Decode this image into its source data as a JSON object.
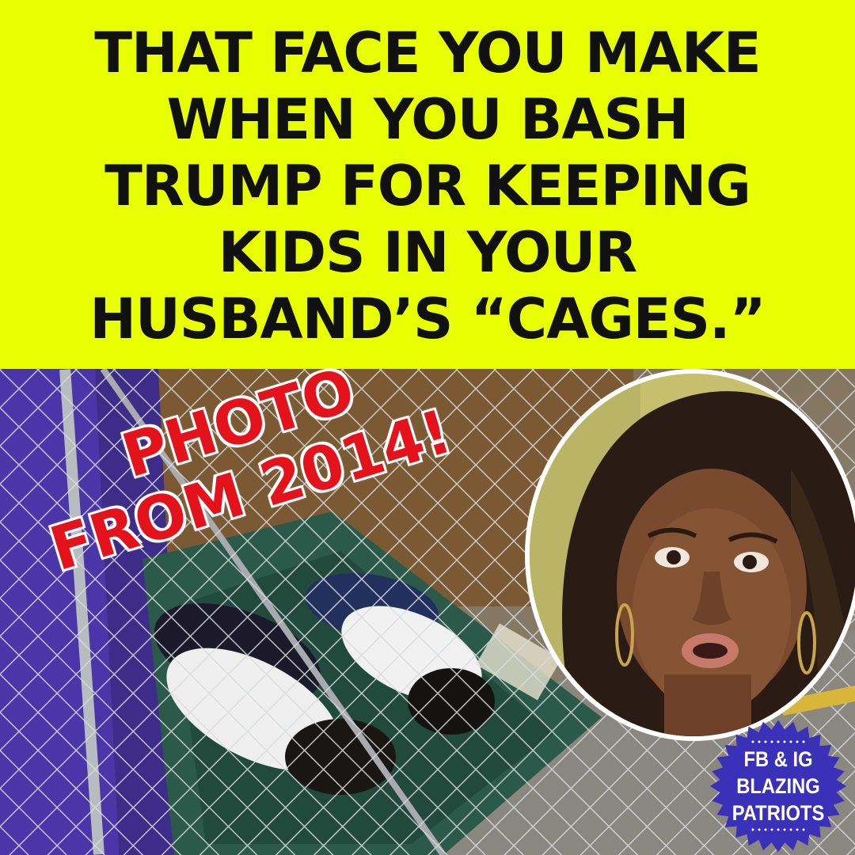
{
  "headline": {
    "lines": [
      "THAT FACE YOU MAKE",
      "WHEN YOU BASH",
      "TRUMP FOR KEEPING",
      "KIDS IN YOUR",
      "HUSBAND’S “CAGES.”"
    ]
  },
  "stamp": {
    "line1": "PHOTO",
    "line2": "FROM 2014!"
  },
  "badge": {
    "line1": "FB & IG",
    "line2": "BLAZING",
    "line3": "PATRIOTS"
  },
  "colors": {
    "headline_bg": "#e8ff00",
    "headline_text": "#111111",
    "stamp_text": "#e3121b",
    "badge_bg": "#3b31b8"
  }
}
